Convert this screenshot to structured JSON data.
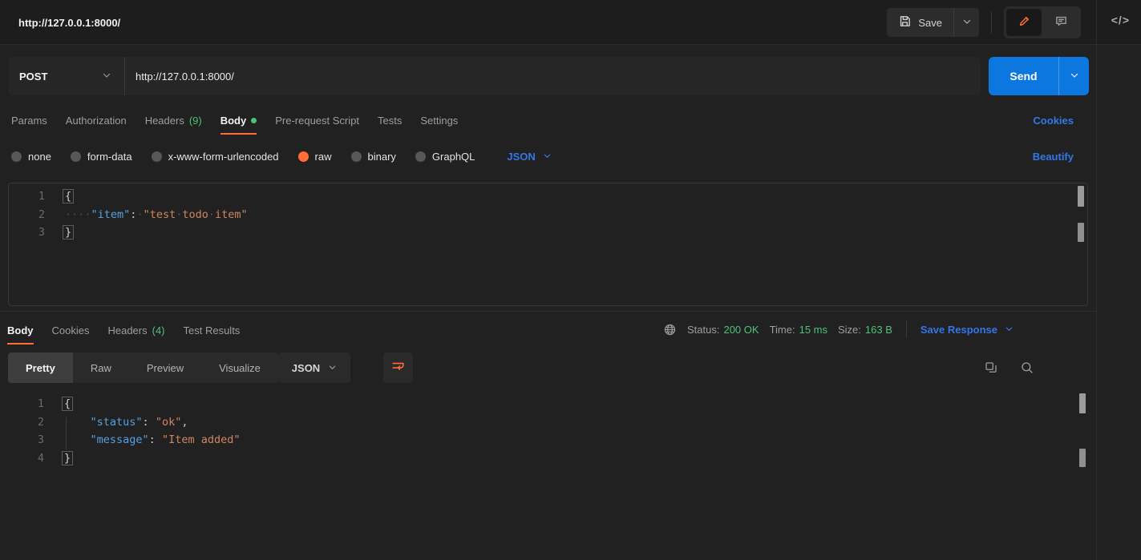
{
  "colors": {
    "accent_orange": "#ff6c37",
    "link_blue": "#3377e6",
    "send_blue": "#0d77e0",
    "success_green": "#4fc27a",
    "code_key_blue": "#56a1e2",
    "code_string_orange": "#ce8661"
  },
  "header": {
    "title": "http://127.0.0.1:8000/",
    "save_label": "Save",
    "code_snippet_icon": "</>"
  },
  "request": {
    "method": "POST",
    "url": "http://127.0.0.1:8000/",
    "send_label": "Send",
    "cookies_link": "Cookies",
    "beautify_link": "Beautify",
    "language": "JSON",
    "tabs": [
      {
        "label": "Params"
      },
      {
        "label": "Authorization"
      },
      {
        "label": "Headers",
        "count": "(9)"
      },
      {
        "label": "Body",
        "active": true,
        "has_dot": true
      },
      {
        "label": "Pre-request Script"
      },
      {
        "label": "Tests"
      },
      {
        "label": "Settings"
      }
    ],
    "body_modes": [
      {
        "label": "none"
      },
      {
        "label": "form-data"
      },
      {
        "label": "x-www-form-urlencoded"
      },
      {
        "label": "raw",
        "selected": true
      },
      {
        "label": "binary"
      },
      {
        "label": "GraphQL"
      }
    ],
    "editor_lines": [
      {
        "num": "1",
        "tokens": [
          {
            "c": "bracket",
            "v": "{"
          }
        ]
      },
      {
        "num": "2",
        "tokens": [
          {
            "c": "ws",
            "v": "····"
          },
          {
            "c": "key",
            "v": "\"item\""
          },
          {
            "c": "punct",
            "v": ":"
          },
          {
            "c": "ws",
            "v": "·"
          },
          {
            "c": "str",
            "v": "\"test"
          },
          {
            "c": "wsdot",
            "v": "·"
          },
          {
            "c": "str",
            "v": "todo"
          },
          {
            "c": "wsdot",
            "v": "·"
          },
          {
            "c": "str",
            "v": "item\""
          }
        ]
      },
      {
        "num": "3",
        "tokens": [
          {
            "c": "bracket",
            "v": "}"
          }
        ]
      }
    ]
  },
  "response": {
    "tabs": [
      {
        "label": "Body",
        "active": true
      },
      {
        "label": "Cookies"
      },
      {
        "label": "Headers",
        "count": "(4)"
      },
      {
        "label": "Test Results"
      }
    ],
    "status_label": "Status:",
    "status_value": "200 OK",
    "time_label": "Time:",
    "time_value": "15 ms",
    "size_label": "Size:",
    "size_value": "163 B",
    "save_response_label": "Save Response",
    "view_tabs": [
      {
        "label": "Pretty",
        "active": true
      },
      {
        "label": "Raw"
      },
      {
        "label": "Preview"
      },
      {
        "label": "Visualize"
      }
    ],
    "language": "JSON",
    "editor_lines": [
      {
        "num": "1",
        "tokens": [
          {
            "c": "bracket",
            "v": "{"
          }
        ]
      },
      {
        "num": "2",
        "tokens": [
          {
            "c": "ws",
            "v": "    "
          },
          {
            "c": "key",
            "v": "\"status\""
          },
          {
            "c": "punct",
            "v": ": "
          },
          {
            "c": "str",
            "v": "\"ok\""
          },
          {
            "c": "punct",
            "v": ","
          }
        ]
      },
      {
        "num": "3",
        "tokens": [
          {
            "c": "ws",
            "v": "    "
          },
          {
            "c": "key",
            "v": "\"message\""
          },
          {
            "c": "punct",
            "v": ": "
          },
          {
            "c": "str",
            "v": "\"Item added\""
          }
        ]
      },
      {
        "num": "4",
        "tokens": [
          {
            "c": "bracket",
            "v": "}"
          }
        ]
      }
    ]
  }
}
